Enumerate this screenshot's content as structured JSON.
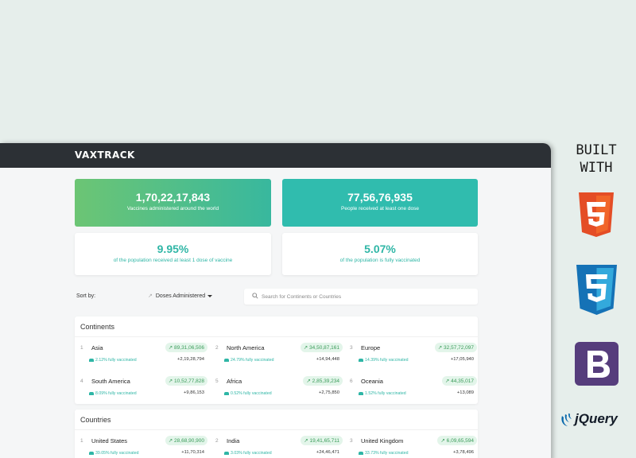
{
  "app": {
    "logo": "VAXTRACK"
  },
  "stats": {
    "vaccines": {
      "value": "1,70,22,17,843",
      "label": "Vaccines administered around the world"
    },
    "people": {
      "value": "77,56,76,935",
      "label": "People received at least one dose"
    },
    "one_dose": {
      "value": "9.95%",
      "label": "of the population received at least 1 dose of vaccine"
    },
    "fully": {
      "value": "5.07%",
      "label": "of the population is fully vaccinated"
    }
  },
  "sort": {
    "label": "Sort by:",
    "selected": "Doses Administered"
  },
  "search": {
    "placeholder": "Search for Continents or Countries"
  },
  "continents": {
    "title": "Continents",
    "items": [
      {
        "idx": "1",
        "name": "Asia",
        "doses": "89,31,06,506",
        "pct": "2.12% fully vaccinated",
        "delta": "+2,19,28,794"
      },
      {
        "idx": "2",
        "name": "North America",
        "doses": "34,50,87,161",
        "pct": "24.79% fully vaccinated",
        "delta": "+14,94,448"
      },
      {
        "idx": "3",
        "name": "Europe",
        "doses": "32,57,72,097",
        "pct": "14.39% fully vaccinated",
        "delta": "+17,05,940"
      },
      {
        "idx": "4",
        "name": "South America",
        "doses": "10,52,77,828",
        "pct": "8.09% fully vaccinated",
        "delta": "+9,86,153"
      },
      {
        "idx": "5",
        "name": "Africa",
        "doses": "2,85,39,234",
        "pct": "0.52% fully vaccinated",
        "delta": "+2,75,850"
      },
      {
        "idx": "6",
        "name": "Oceania",
        "doses": "44,35,017",
        "pct": "1.52% fully vaccinated",
        "delta": "+13,089"
      }
    ]
  },
  "countries": {
    "title": "Countries",
    "items": [
      {
        "idx": "1",
        "name": "United States",
        "doses": "28,68,90,900",
        "pct": "39.05% fully vaccinated",
        "delta": "+11,70,314"
      },
      {
        "idx": "2",
        "name": "India",
        "doses": "19,41,65,711",
        "pct": "3.03% fully vaccinated",
        "delta": "+24,46,471"
      },
      {
        "idx": "3",
        "name": "United Kingdom",
        "doses": "6,09,65,594",
        "pct": "33.73% fully vaccinated",
        "delta": "+3,78,496"
      }
    ]
  },
  "built_with": {
    "line1": "BUILT",
    "line2": "WITH",
    "jquery": "jQuery"
  },
  "colors": {
    "accent": "#2fb6a6",
    "topbar": "#2c3035",
    "green": "#6cc574"
  }
}
